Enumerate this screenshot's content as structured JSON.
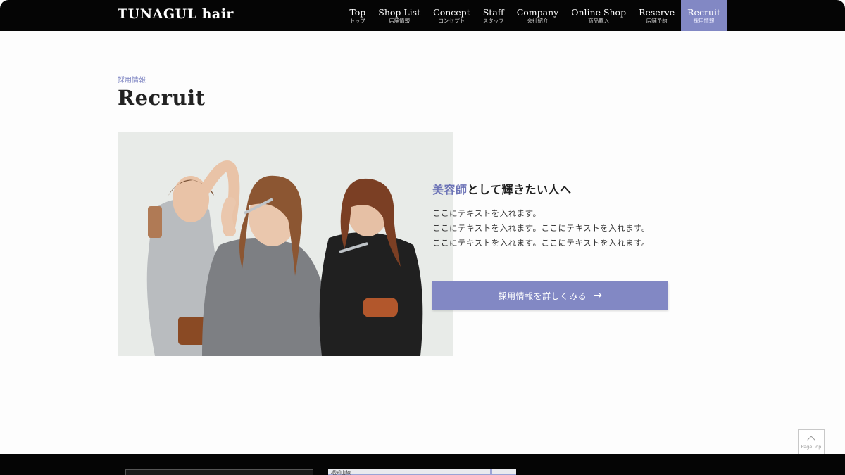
{
  "brand": {
    "logo": "TUNAGUL hair"
  },
  "nav": {
    "items": [
      {
        "en": "Top",
        "ja": "トップ"
      },
      {
        "en": "Shop List",
        "ja": "店舗情報"
      },
      {
        "en": "Concept",
        "ja": "コンセプト"
      },
      {
        "en": "Staff",
        "ja": "スタッフ"
      },
      {
        "en": "Company",
        "ja": "会社紹介"
      },
      {
        "en": "Online Shop",
        "ja": "商品購入"
      },
      {
        "en": "Reserve",
        "ja": "店舗予約"
      },
      {
        "en": "Recruit",
        "ja": "採用情報"
      }
    ],
    "active_index": 7
  },
  "recruit": {
    "sub": "採用情報",
    "title": "Recruit",
    "headline_accent": "美容師",
    "headline_rest": "として輝きたい人へ",
    "body_lines": [
      "ここにテキストを入れます。",
      "ここにテキストを入れます。ここにテキストを入れます。",
      "ここにテキストを入れます。ここにテキストを入れます。"
    ],
    "cta_label": "採用情報を詳しくみる",
    "cta_arrow": "→"
  },
  "page_top": {
    "label": "Page Top"
  },
  "footer": {
    "map_label": "福知山線"
  },
  "colors": {
    "accent": "#8288c4",
    "header_bg": "#050505",
    "accent_text": "#6d74b7"
  }
}
